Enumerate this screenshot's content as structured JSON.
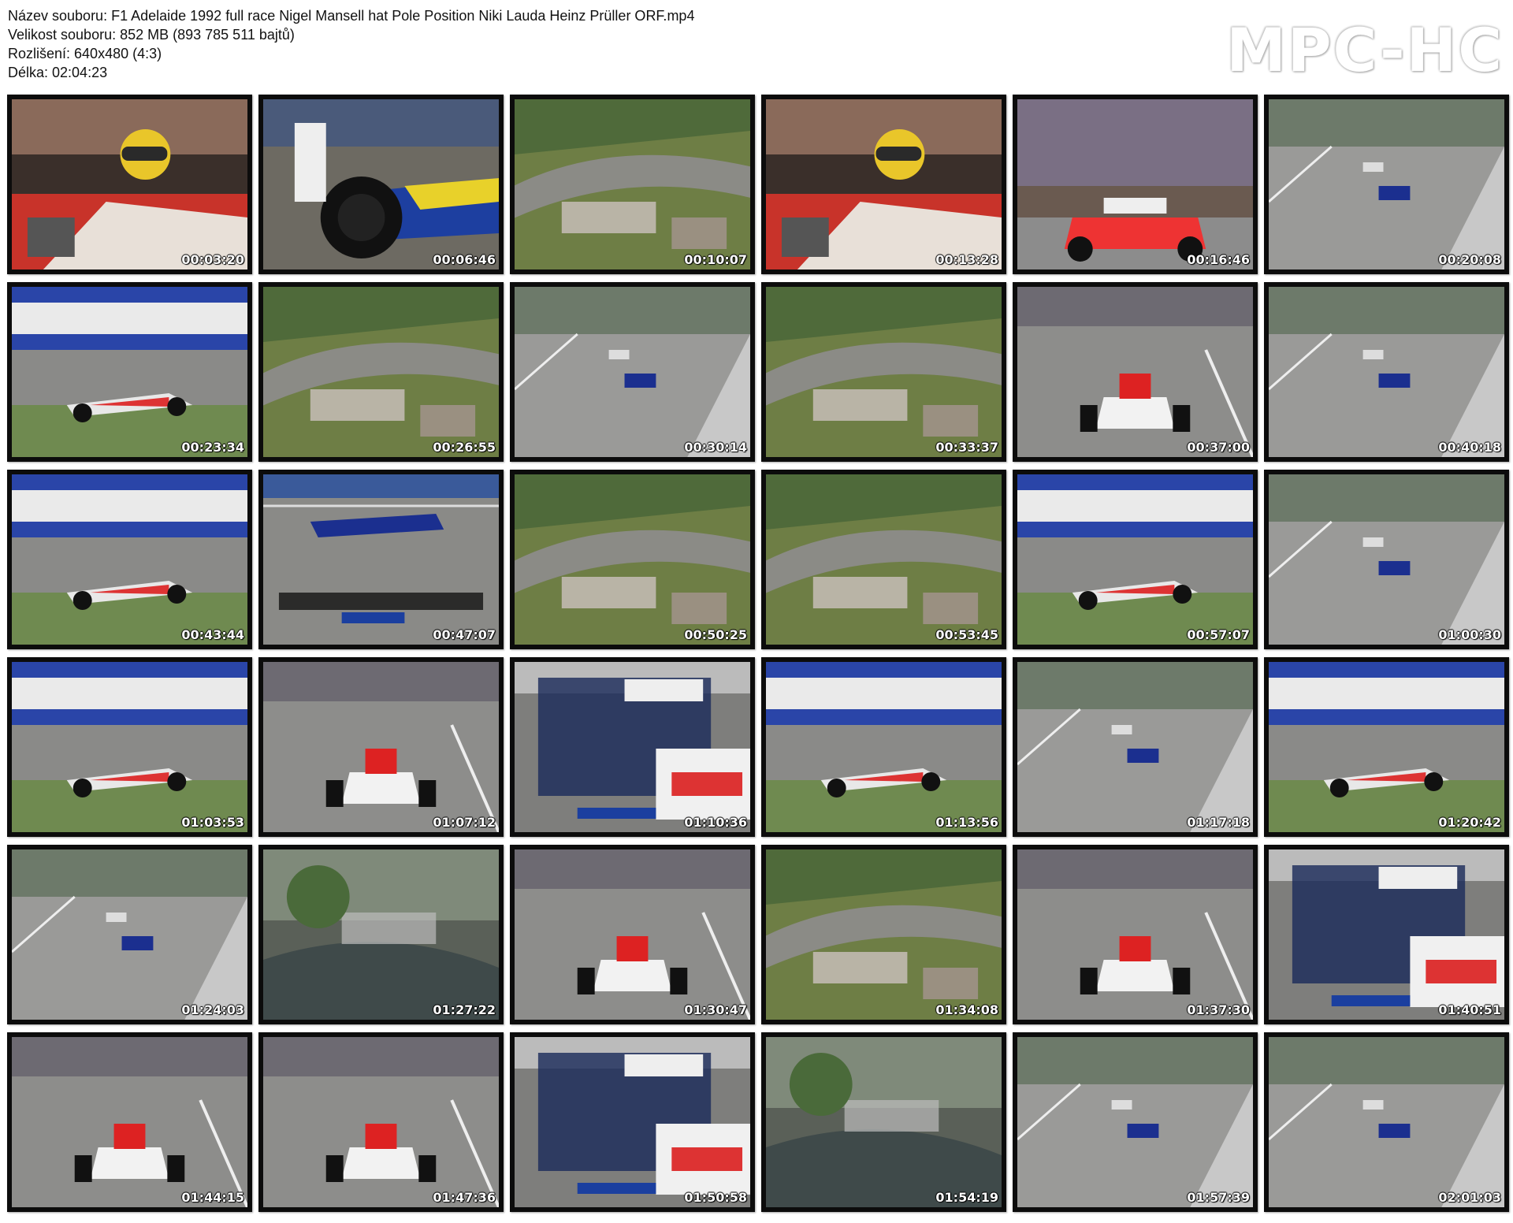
{
  "info": {
    "filename_line": "Název souboru: F1 Adelaide 1992 full race Nigel Mansell hat Pole Position Niki Lauda Heinz Prüller ORF.mp4",
    "size_line": "Velikost souboru: 852 MB (893 785 511 bajtů)",
    "resolution_line": "Rozlišení: 640x480 (4:3)",
    "duration_line": "Délka: 02:04:23"
  },
  "logo": "MPC-HC",
  "thumbnails": [
    {
      "time": "00:03:20",
      "scene": "cockpit"
    },
    {
      "time": "00:06:46",
      "scene": "pit"
    },
    {
      "time": "00:10:07",
      "scene": "aerial"
    },
    {
      "time": "00:13:28",
      "scene": "cockpit"
    },
    {
      "time": "00:16:46",
      "scene": "crowd"
    },
    {
      "time": "00:20:08",
      "scene": "straight"
    },
    {
      "time": "00:23:34",
      "scene": "sidecar"
    },
    {
      "time": "00:26:55",
      "scene": "aerial"
    },
    {
      "time": "00:30:14",
      "scene": "straight"
    },
    {
      "time": "00:33:37",
      "scene": "aerial"
    },
    {
      "time": "00:37:00",
      "scene": "front"
    },
    {
      "time": "00:40:18",
      "scene": "straight"
    },
    {
      "time": "00:43:44",
      "scene": "sidecar"
    },
    {
      "time": "00:47:07",
      "scene": "timing"
    },
    {
      "time": "00:50:25",
      "scene": "aerial"
    },
    {
      "time": "00:53:45",
      "scene": "aerial"
    },
    {
      "time": "00:57:07",
      "scene": "sidecar"
    },
    {
      "time": "01:00:30",
      "scene": "straight"
    },
    {
      "time": "01:03:53",
      "scene": "sidecar"
    },
    {
      "time": "01:07:12",
      "scene": "front"
    },
    {
      "time": "01:10:36",
      "scene": "standings"
    },
    {
      "time": "01:13:56",
      "scene": "sidecar"
    },
    {
      "time": "01:17:18",
      "scene": "straight"
    },
    {
      "time": "01:20:42",
      "scene": "sidecar"
    },
    {
      "time": "01:24:03",
      "scene": "straight"
    },
    {
      "time": "01:27:22",
      "scene": "blur"
    },
    {
      "time": "01:30:47",
      "scene": "front"
    },
    {
      "time": "01:34:08",
      "scene": "aerial"
    },
    {
      "time": "01:37:30",
      "scene": "front"
    },
    {
      "time": "01:40:51",
      "scene": "standings"
    },
    {
      "time": "01:44:15",
      "scene": "front"
    },
    {
      "time": "01:47:36",
      "scene": "front"
    },
    {
      "time": "01:50:58",
      "scene": "standings"
    },
    {
      "time": "01:54:19",
      "scene": "blur"
    },
    {
      "time": "01:57:39",
      "scene": "straight"
    },
    {
      "time": "02:01:03",
      "scene": "straight"
    }
  ]
}
